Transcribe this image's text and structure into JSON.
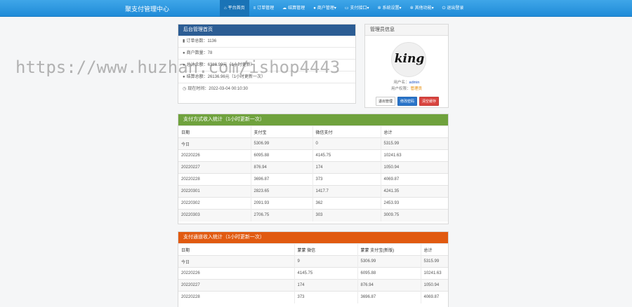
{
  "header": {
    "brand": "聚支付管理中心",
    "nav": [
      {
        "label": "平台首页",
        "icon": "⌂",
        "active": true
      },
      {
        "label": "订单管理",
        "icon": "≡",
        "active": false
      },
      {
        "label": "结算管理",
        "icon": "☁",
        "active": false
      },
      {
        "label": "商户管理▾",
        "icon": "●",
        "active": false
      },
      {
        "label": "支付接口▾",
        "icon": "▭",
        "active": false
      },
      {
        "label": "系统设置▾",
        "icon": "✲",
        "active": false
      },
      {
        "label": "其他功能▾",
        "icon": "✲",
        "active": false
      },
      {
        "label": "退出登录",
        "icon": "⏻",
        "active": false
      }
    ]
  },
  "overview": {
    "title": "后台管理首页",
    "rows": [
      {
        "icon": "▮",
        "text": "订单总数：1136"
      },
      {
        "icon": "●",
        "text": "商户数量：78"
      },
      {
        "icon": "●",
        "text": "总计余额：6318.99元（1小时更新）"
      },
      {
        "icon": "●",
        "text": "结算总额：26136.96元（1小时更新一次）"
      },
      {
        "icon": "◷",
        "text": "现在时间：2022-03-04 00:10:30"
      }
    ]
  },
  "admin": {
    "title": "管理员信息",
    "avatar_text": "king",
    "username_label": "用户名：",
    "username": "admin",
    "role_label": "用户权限：",
    "role": "管理员",
    "buttons": {
      "logout": "退出管理",
      "change_password": "修改密码",
      "clear_cache": "清空缓存"
    }
  },
  "payment_type": {
    "title": "支付方式收入统计（1小时更新一次）",
    "headers": [
      "日期",
      "支付宝",
      "微信支付",
      "总计"
    ],
    "rows": [
      [
        "今日",
        "5306.99",
        "0",
        "5315.99"
      ],
      [
        "20220226",
        "6095.88",
        "4145.75",
        "10241.63"
      ],
      [
        "20220227",
        "876.94",
        "174",
        "1050.94"
      ],
      [
        "20220228",
        "3696.87",
        "373",
        "4069.87"
      ],
      [
        "20220301",
        "2823.65",
        "1417.7",
        "4241.35"
      ],
      [
        "20220302",
        "2091.93",
        "362",
        "2453.93"
      ],
      [
        "20220303",
        "2706.75",
        "303",
        "3009.75"
      ]
    ]
  },
  "channel": {
    "title": "支付通道收入统计（1小时更新一次）",
    "headers": [
      "日期",
      "蒙蒙 微信",
      "蒙蒙 支付宝(新版)",
      "总计"
    ],
    "rows": [
      [
        "今日",
        "9",
        "5306.99",
        "5315.99"
      ],
      [
        "20220226",
        "4145.75",
        "6095.88",
        "10241.63"
      ],
      [
        "20220227",
        "174",
        "876.94",
        "1050.94"
      ],
      [
        "20220228",
        "373",
        "3696.87",
        "4069.87"
      ]
    ]
  },
  "watermark": "https://www.huzhan.com/ishop4443"
}
